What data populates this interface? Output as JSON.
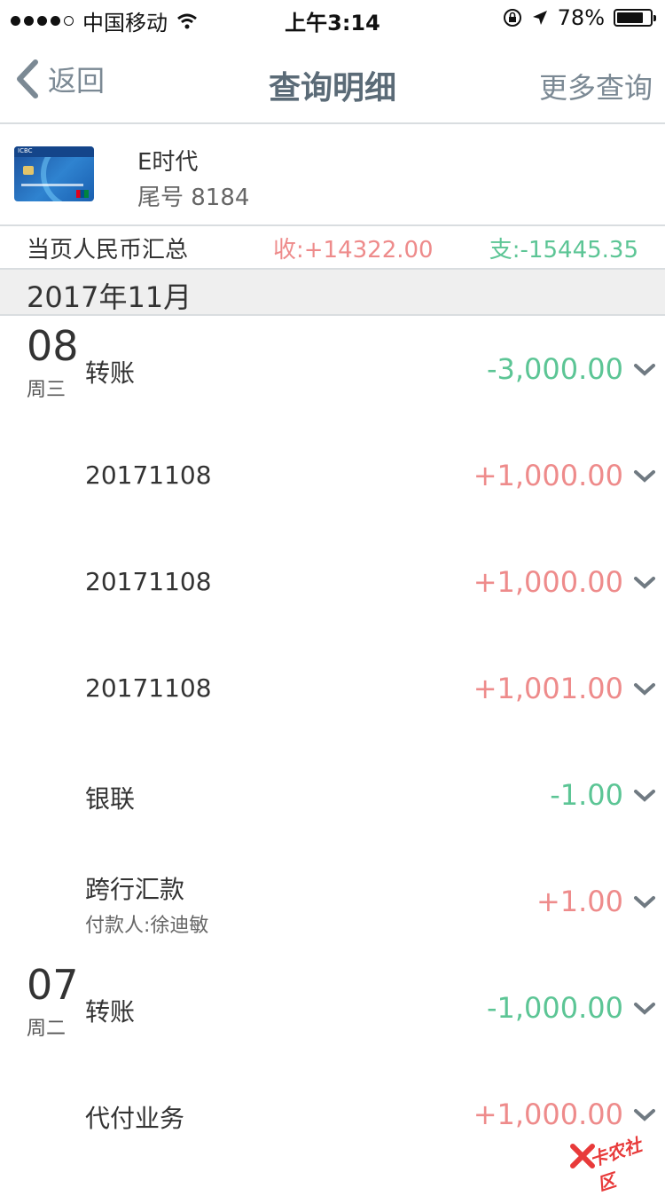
{
  "status": {
    "carrier": "中国移动",
    "time": "上午3:14",
    "battery": "78%",
    "battery_level": 0.78
  },
  "nav": {
    "back_label": "返回",
    "title": "查询明细",
    "more_label": "更多查询"
  },
  "account": {
    "name": "E时代",
    "tail": "尾号 8184"
  },
  "summary": {
    "label": "当页人民币汇总",
    "income": "收:+14322.00",
    "expense": "支:-15445.35"
  },
  "month": "2017年11月",
  "transactions": [
    {
      "day": "08",
      "weekday": "周三",
      "desc": "转账",
      "sub": "",
      "amount": "-3,000.00",
      "sign": "neg"
    },
    {
      "day": "",
      "weekday": "",
      "desc": "20171108",
      "sub": "",
      "amount": "+1,000.00",
      "sign": "pos"
    },
    {
      "day": "",
      "weekday": "",
      "desc": "20171108",
      "sub": "",
      "amount": "+1,000.00",
      "sign": "pos"
    },
    {
      "day": "",
      "weekday": "",
      "desc": "20171108",
      "sub": "",
      "amount": "+1,001.00",
      "sign": "pos"
    },
    {
      "day": "",
      "weekday": "",
      "desc": "银联",
      "sub": "",
      "amount": "-1.00",
      "sign": "neg"
    },
    {
      "day": "",
      "weekday": "",
      "desc": "跨行汇款",
      "sub": "付款人:徐迪敏",
      "amount": "+1.00",
      "sign": "pos"
    },
    {
      "day": "07",
      "weekday": "周二",
      "desc": "转账",
      "sub": "",
      "amount": "-1,000.00",
      "sign": "neg"
    },
    {
      "day": "",
      "weekday": "",
      "desc": "代付业务",
      "sub": "",
      "amount": "+1,000.00",
      "sign": "pos"
    }
  ],
  "watermark": "卡农社区",
  "colors": {
    "income": "#ee8b8b",
    "expense": "#5cc595",
    "nav_text": "#7b8994"
  }
}
